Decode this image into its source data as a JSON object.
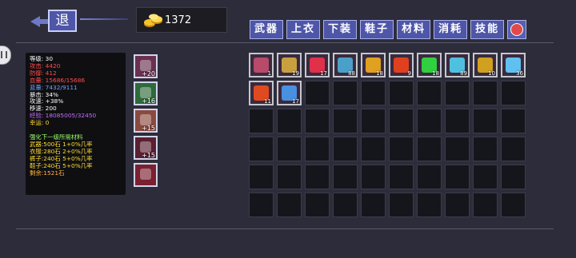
{
  "header": {
    "back_label": "退",
    "gold_amount": "1372"
  },
  "tabs": [
    "武器",
    "上衣",
    "下装",
    "鞋子",
    "材料",
    "消耗",
    "技能"
  ],
  "stats": [
    {
      "text": "等级: 30",
      "color": "w"
    },
    {
      "text": "攻击: 4420",
      "color": "r"
    },
    {
      "text": "防御: 412",
      "color": "r"
    },
    {
      "text": "血量: 15686/15686",
      "color": "r"
    },
    {
      "text": "蓝量: 7432/9111",
      "color": "b"
    },
    {
      "text": "暴击: 34%",
      "color": "w"
    },
    {
      "text": "攻速: +38%",
      "color": "w"
    },
    {
      "text": "移速: 200",
      "color": "w"
    },
    {
      "text": "经验: 18085005/32450",
      "color": "p"
    },
    {
      "text": "幸运: 0",
      "color": "y"
    },
    {
      "text": "",
      "color": "w"
    },
    {
      "text": "强化下一级所需材料",
      "color": "g"
    },
    {
      "text": "武器:500石 1+0%几率",
      "color": "y"
    },
    {
      "text": "衣服:280石 2+0%几率",
      "color": "y"
    },
    {
      "text": "裤子:240石 5+0%几率",
      "color": "y"
    },
    {
      "text": "鞋子:240石 5+0%几率",
      "color": "y"
    },
    {
      "text": "剩余:1521石",
      "color": "o"
    }
  ],
  "equipped": [
    {
      "name": "equipped-weapon",
      "level": "+20",
      "icon": "fire-sword-icon"
    },
    {
      "name": "equipped-armor",
      "level": "+16",
      "icon": "green-shirt-icon"
    },
    {
      "name": "equipped-pants",
      "level": "+15",
      "icon": "pants-icon"
    },
    {
      "name": "equipped-shoes",
      "level": "+15",
      "icon": "boots-icon"
    },
    {
      "name": "equipped-skill",
      "level": "",
      "icon": "demon-skill-icon"
    }
  ],
  "inventory": [
    {
      "icon": "spellbook-icon",
      "count": "1",
      "color": "#b84a6a"
    },
    {
      "icon": "bow-icon",
      "count": "19",
      "color": "#c8a040"
    },
    {
      "icon": "ring-icon",
      "count": "17",
      "color": "#e0304a"
    },
    {
      "icon": "crossbow-icon",
      "count": "88",
      "color": "#4aa0c8"
    },
    {
      "icon": "shield-icon",
      "count": "18",
      "color": "#e0a020"
    },
    {
      "icon": "fire-potion-icon",
      "count": "9",
      "color": "#e04020"
    },
    {
      "icon": "green-blade-icon",
      "count": "18",
      "color": "#30d040"
    },
    {
      "icon": "blue-blade-icon",
      "count": "89",
      "color": "#50c0e0"
    },
    {
      "icon": "gold-statue-icon",
      "count": "10",
      "color": "#d0a020"
    },
    {
      "icon": "frost-gem-icon",
      "count": "36",
      "color": "#60c0f0"
    },
    {
      "icon": "fire-sword-icon",
      "count": "11",
      "color": "#e04a20"
    },
    {
      "icon": "feather-icon",
      "count": "17",
      "color": "#4a90e0"
    }
  ]
}
